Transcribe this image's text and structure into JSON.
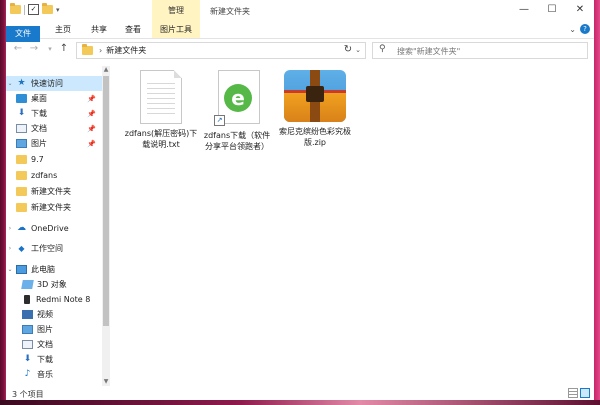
{
  "window": {
    "title": "新建文件夹",
    "manage_tab": "管理",
    "controls": {
      "minimize": "—",
      "maximize": "☐",
      "close": "✕"
    }
  },
  "ribbon": {
    "tabs": [
      "文件",
      "主页",
      "共享",
      "查看",
      "图片工具"
    ],
    "toggle": "⌄",
    "help": "?"
  },
  "address": {
    "path": "新建文件夹",
    "search_placeholder": "搜索\"新建文件夹\""
  },
  "nav": {
    "quick_access": "快速访问",
    "items": [
      {
        "label": "桌面",
        "pinned": true
      },
      {
        "label": "下载",
        "pinned": true
      },
      {
        "label": "文档",
        "pinned": true
      },
      {
        "label": "图片",
        "pinned": true
      },
      {
        "label": "9.7"
      },
      {
        "label": "zdfans"
      },
      {
        "label": "新建文件夹"
      },
      {
        "label": "新建文件夹"
      }
    ],
    "onedrive": "OneDrive",
    "workspace": "工作空间",
    "this_pc": "此电脑",
    "pc_items": [
      "3D 对象",
      "Redmi Note 8",
      "视频",
      "图片",
      "文档",
      "下载",
      "音乐"
    ]
  },
  "files": [
    {
      "name": "zdfans(解压密码)下载说明.txt",
      "type": "txt"
    },
    {
      "name": "zdfans下载（软件分享平台领跑者）",
      "type": "shortcut"
    },
    {
      "name": "索尼克缤纷色彩究极版.zip",
      "type": "zip"
    }
  ],
  "status": {
    "count": "3 个项目"
  }
}
